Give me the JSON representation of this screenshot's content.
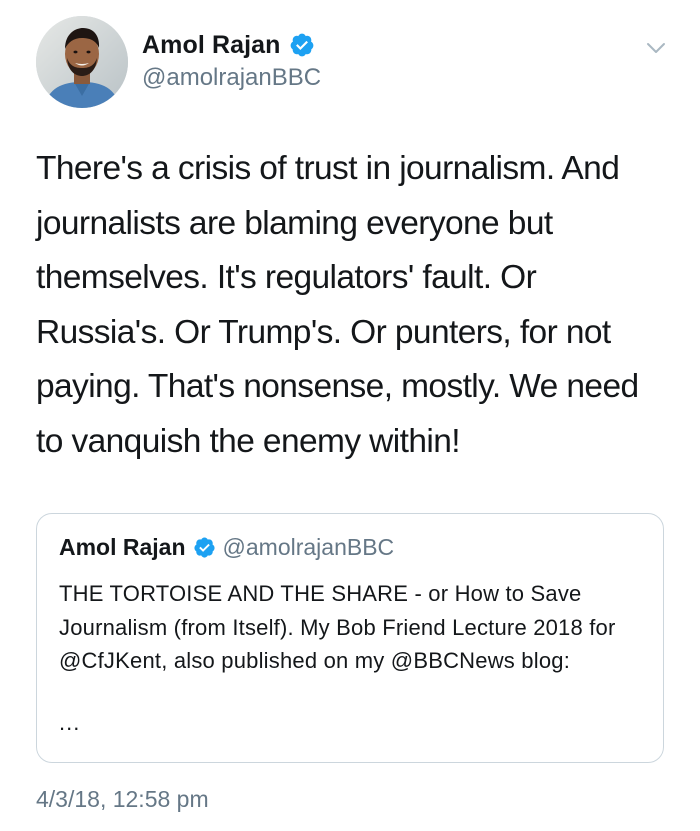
{
  "author": {
    "name": "Amol Rajan",
    "handle": "@amolrajanBBC",
    "verified": true,
    "avatar_icon": "profile-photo"
  },
  "tweet": {
    "text": "There's a crisis of trust in journalism. And journalists are blaming everyone but themselves. It's regulators' fault. Or Russia's. Or Trump's. Or punters, for not paying. That's nonsense, mostly. We need to vanquish the enemy within!",
    "timestamp": "4/3/18, 12:58 pm"
  },
  "quoted_tweet": {
    "name": "Amol Rajan",
    "handle": "@amolrajanBBC",
    "verified": true,
    "text": "THE TORTOISE AND THE SHARE - or How to Save Journalism (from Itself). My Bob Friend Lecture 2018 for @CfJKent, also published on my @BBCNews blog:",
    "ellipsis": "..."
  },
  "icons": {
    "verified": "verified-badge-icon",
    "menu": "chevron-down-icon"
  },
  "colors": {
    "verified_blue": "#1da1f2",
    "text_primary": "#14171a",
    "text_secondary": "#657786",
    "border": "#ccd6dd"
  }
}
